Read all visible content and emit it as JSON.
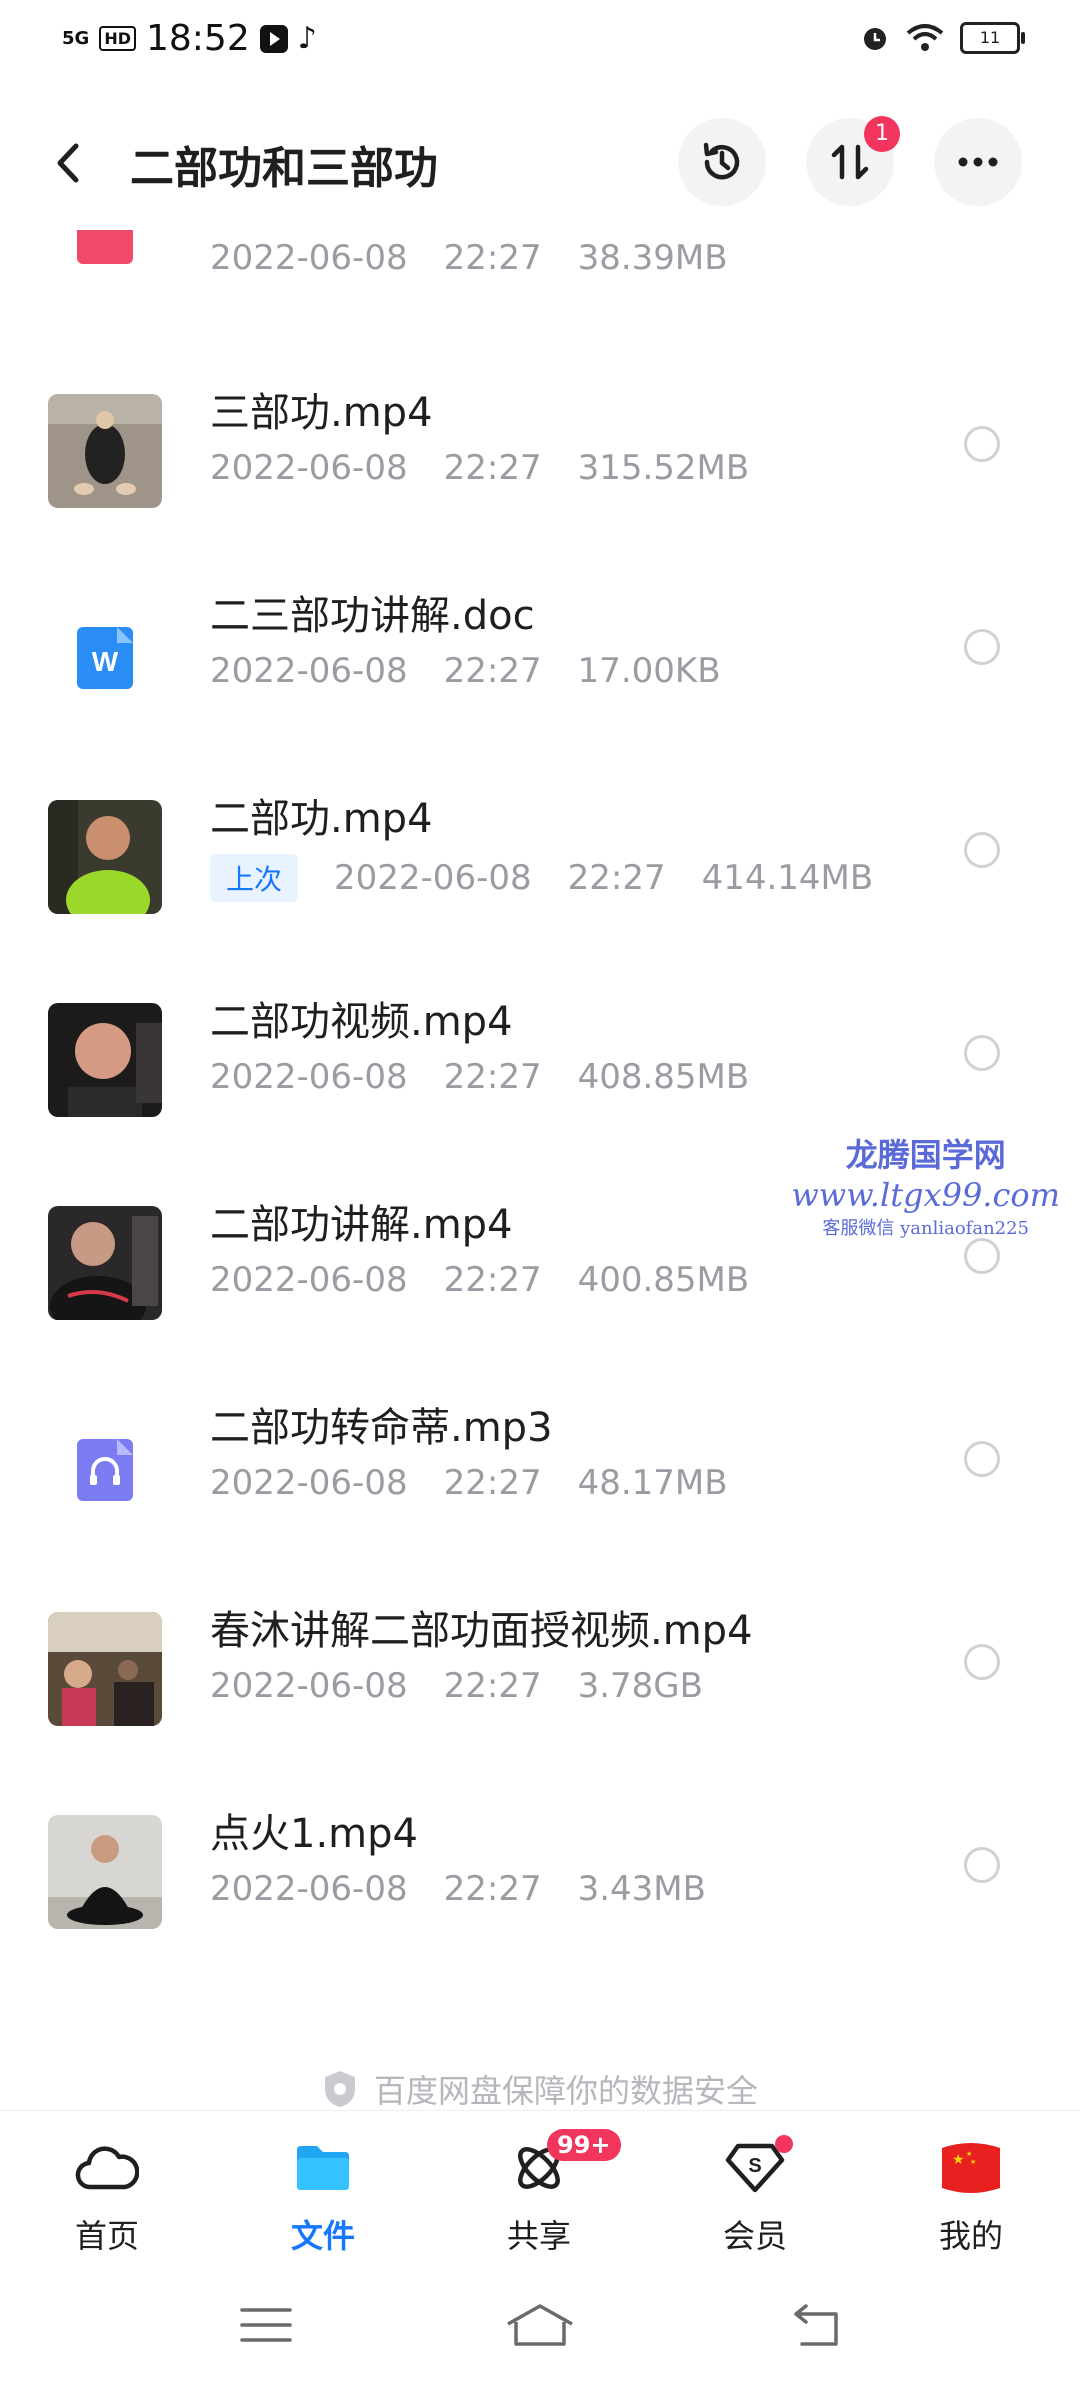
{
  "status_bar": {
    "network": "5G",
    "hd": "HD",
    "time": "18:52",
    "battery": "11"
  },
  "header": {
    "title": "二部功和三部功",
    "badge_count": "1"
  },
  "files": [
    {
      "name": "",
      "date": "2022-06-08",
      "time": "22:27",
      "size": "38.39MB",
      "kind": "partial"
    },
    {
      "name": "三部功.mp4",
      "date": "2022-06-08",
      "time": "22:27",
      "size": "315.52MB",
      "kind": "video"
    },
    {
      "name": "二三部功讲解.doc",
      "date": "2022-06-08",
      "time": "22:27",
      "size": "17.00KB",
      "kind": "doc"
    },
    {
      "name": "二部功.mp4",
      "tag": "上次",
      "date": "2022-06-08",
      "time": "22:27",
      "size": "414.14MB",
      "kind": "video"
    },
    {
      "name": "二部功视频.mp4",
      "date": "2022-06-08",
      "time": "22:27",
      "size": "408.85MB",
      "kind": "video"
    },
    {
      "name": "二部功讲解.mp4",
      "date": "2022-06-08",
      "time": "22:27",
      "size": "400.85MB",
      "kind": "video"
    },
    {
      "name": "二部功转命蒂.mp3",
      "date": "2022-06-08",
      "time": "22:27",
      "size": "48.17MB",
      "kind": "audio"
    },
    {
      "name": "春沐讲解二部功面授视频.mp4",
      "date": "2022-06-08",
      "time": "22:27",
      "size": "3.78GB",
      "kind": "video"
    },
    {
      "name": "点火1.mp4",
      "date": "2022-06-08",
      "time": "22:27",
      "size": "3.43MB",
      "kind": "video"
    }
  ],
  "watermark": {
    "line1": "龙腾国学网",
    "line2": "www.ltgx99.com",
    "line3": "客服微信 yanliaofan225"
  },
  "footer_note": "百度网盘保障你的数据安全",
  "tabs": [
    {
      "label": "首页",
      "icon": "cloud-icon"
    },
    {
      "label": "文件",
      "icon": "folder-icon",
      "active": true
    },
    {
      "label": "共享",
      "icon": "share-icon",
      "badge": "99+"
    },
    {
      "label": "会员",
      "icon": "vip-icon"
    },
    {
      "label": "我的",
      "icon": "flag-avatar-icon"
    }
  ],
  "colors": {
    "accent": "#1677ff",
    "badge": "#f2355d",
    "meta_text": "#9a9ca3"
  }
}
